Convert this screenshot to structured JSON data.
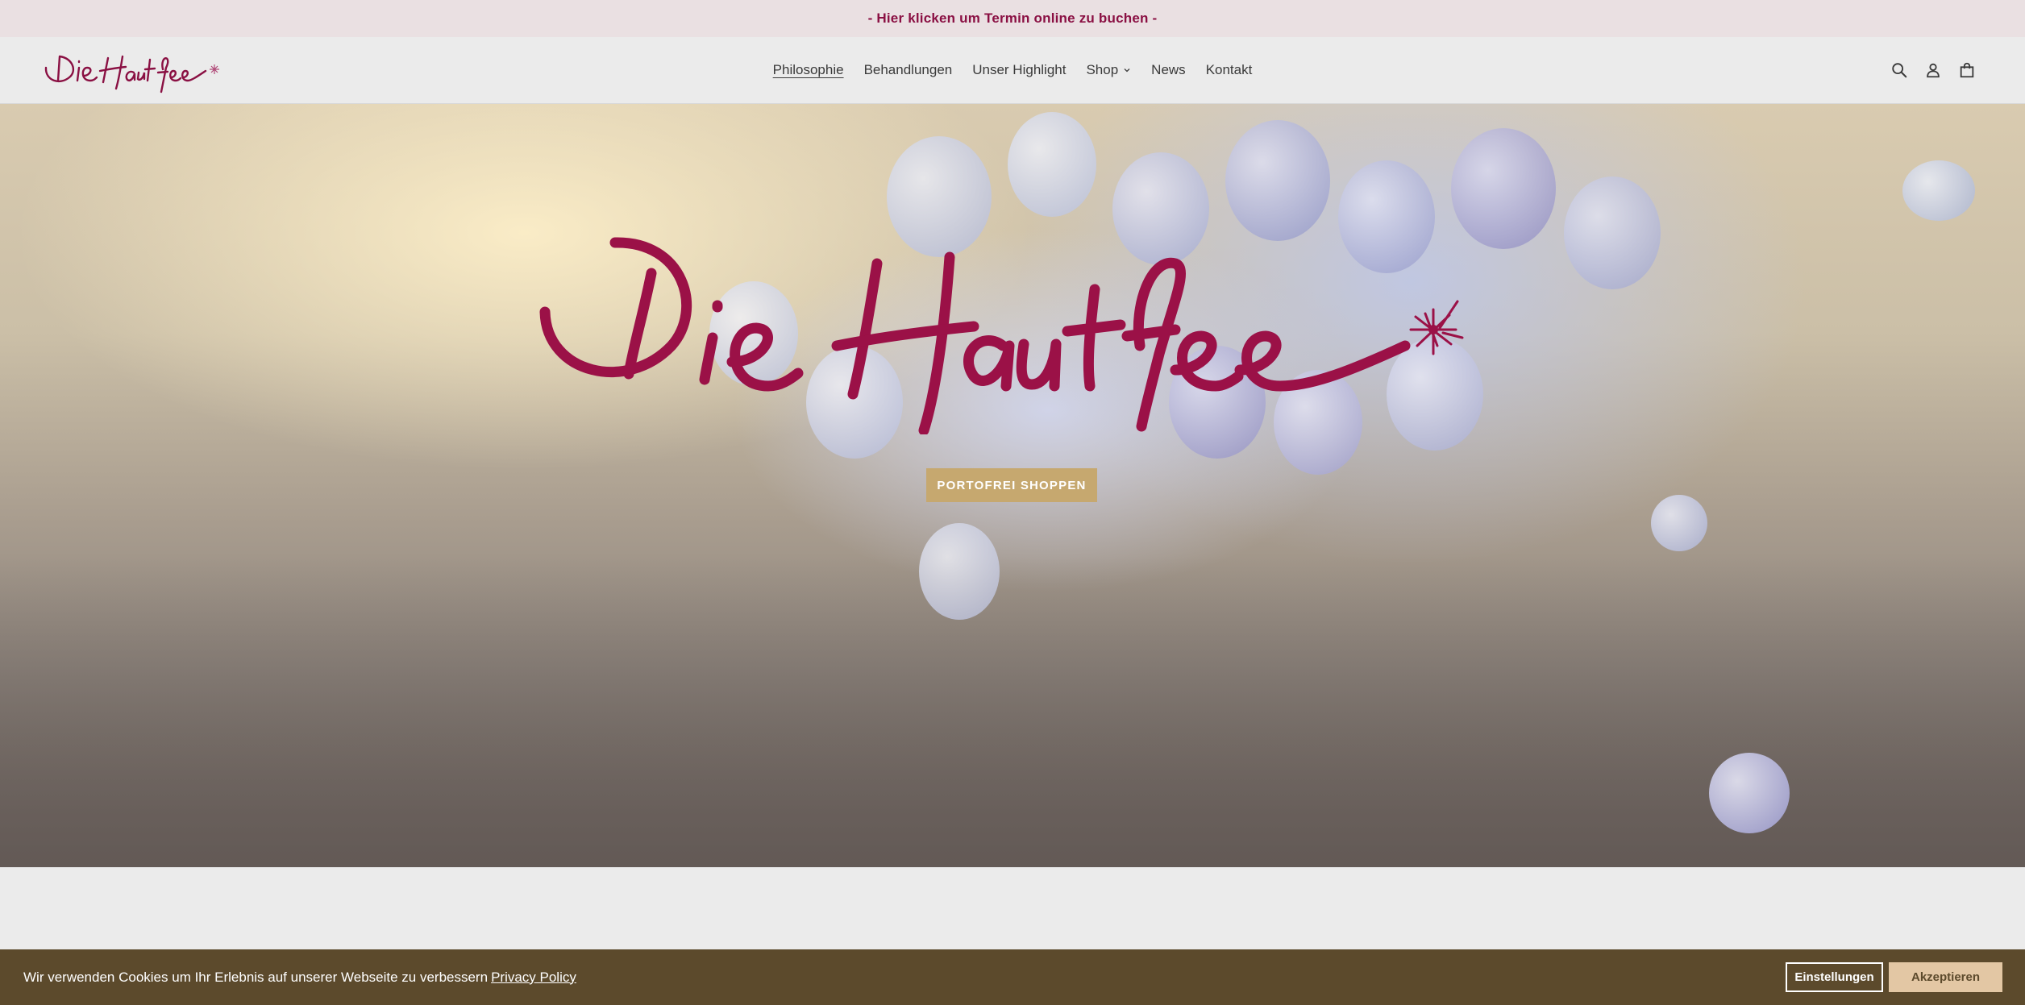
{
  "announcement": {
    "text": "- Hier klicken um Termin online zu buchen -"
  },
  "header": {
    "logo_text": "Die Hautfee",
    "nav": [
      {
        "label": "Philosophie",
        "active": true
      },
      {
        "label": "Behandlungen"
      },
      {
        "label": "Unser Highlight"
      },
      {
        "label": "Shop",
        "has_dropdown": true
      },
      {
        "label": "News"
      },
      {
        "label": "Kontakt"
      }
    ],
    "icons": [
      "search-icon",
      "account-icon",
      "cart-icon"
    ]
  },
  "hero": {
    "logo_text": "Die Hautfee",
    "button_label": "PORTOFREI SHOPPEN"
  },
  "cookie_bar": {
    "text": "Wir verwenden Cookies um Ihr Erlebnis auf unserer Webseite zu verbessern",
    "link_label": "Privacy Policy",
    "settings_label": "Einstellungen",
    "accept_label": "Akzeptieren"
  },
  "colors": {
    "brand": "#8a1043",
    "announcement_bg": "#eae0e2",
    "header_bg": "#ebebeb",
    "hero_button": "#c6a86f",
    "cookie_bg": "#5c4a2c",
    "accept_button": "#e3c7a4"
  }
}
